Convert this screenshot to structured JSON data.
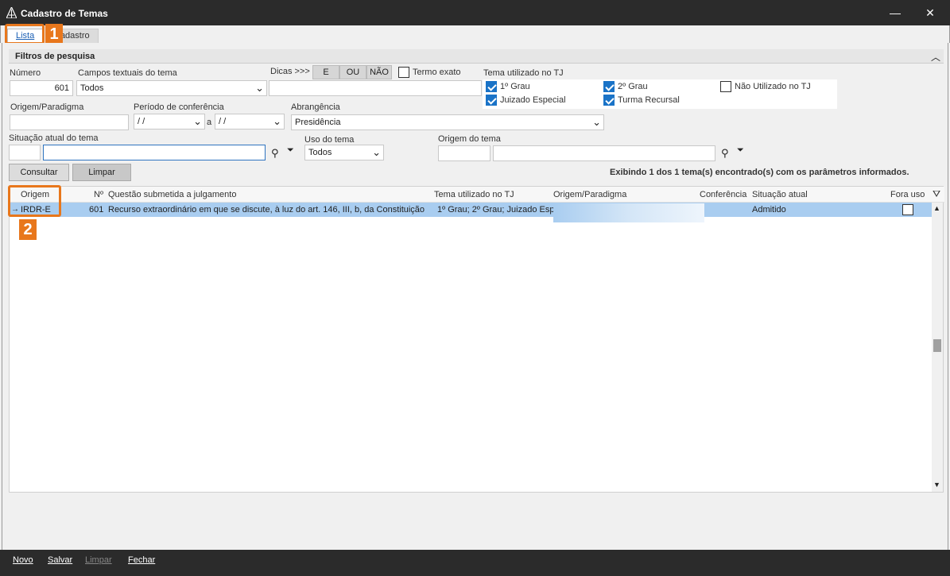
{
  "window": {
    "title": "Cadastro de Temas",
    "minimize": "—",
    "close": "✕"
  },
  "tabs": [
    {
      "label": "Lista"
    },
    {
      "label": "Cadastro"
    }
  ],
  "callouts": {
    "one": "1",
    "two": "2"
  },
  "filters": {
    "title": "Filtros de pesquisa",
    "numero": {
      "label": "Número",
      "value": "601"
    },
    "campos": {
      "label": "Campos textuais do tema",
      "value": "Todos"
    },
    "dicas": {
      "label": "Dicas >>>",
      "e": "E",
      "ou": "OU",
      "nao": "NÃO",
      "value": ""
    },
    "termo_exato": {
      "label": "Termo exato",
      "checked": false
    },
    "tema_tj": {
      "label": "Tema utilizado no TJ",
      "grau1": {
        "label": "1º Grau",
        "checked": true
      },
      "grau2": {
        "label": "2º Grau",
        "checked": true
      },
      "nao_utilizado": {
        "label": "Não Utilizado no TJ",
        "checked": false
      },
      "juizado": {
        "label": "Juizado Especial",
        "checked": true
      },
      "turma": {
        "label": "Turma Recursal",
        "checked": true
      }
    },
    "origem_paradigma": {
      "label": "Origem/Paradigma",
      "value": ""
    },
    "periodo": {
      "label": "Período de conferência",
      "from": " /  /",
      "sep": "a",
      "to": " /  /"
    },
    "abrangencia": {
      "label": "Abrangência",
      "value": "Presidência"
    },
    "situacao": {
      "label": "Situação atual do tema",
      "code": "",
      "value": ""
    },
    "uso": {
      "label": "Uso do tema",
      "value": "Todos"
    },
    "origem_tema": {
      "label": "Origem do tema",
      "code": "",
      "value": ""
    }
  },
  "actions": {
    "consultar": "Consultar",
    "limpar": "Limpar"
  },
  "result_text": "Exibindo 1 dos 1 tema(s) encontrado(s) com os parâmetros informados.",
  "grid": {
    "columns": {
      "origem": "Origem",
      "numero": "Nº",
      "questao": "Questão submetida a julgamento",
      "tema_tj": "Tema utilizado no TJ",
      "origem_paradigma": "Origem/Paradigma",
      "conferencia": "Conferência",
      "situacao": "Situação atual",
      "fora_uso": "Fora uso"
    },
    "rows": [
      {
        "origem": "IRDR-E",
        "numero": "601",
        "questao": "Recurso extraordinário em que se discute, à luz do art. 146, III, b, da Constituição",
        "tema_tj": "1º Grau; 2º Grau; Juizado Esp",
        "conferencia": "",
        "situacao": "Admitido",
        "fora_uso": false
      }
    ]
  },
  "footer": {
    "novo": "Novo",
    "salvar": "Salvar",
    "limpar": "Limpar",
    "fechar": "Fechar"
  }
}
